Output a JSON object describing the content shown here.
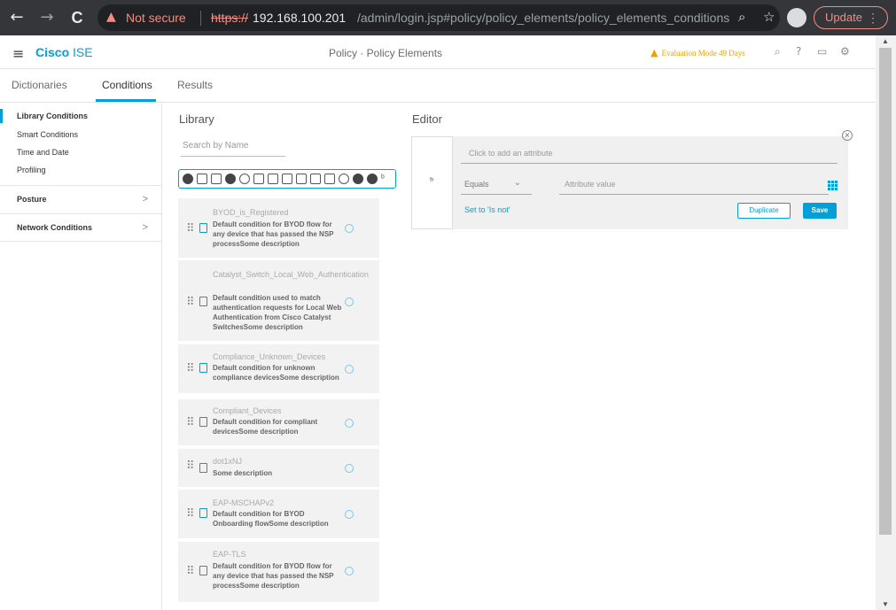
{
  "browser": {
    "not_secure": "Not secure",
    "url_scheme": "https://",
    "url_host": "192.168.100.201",
    "url_path": "/admin/login.jsp#policy/policy_elements/policy_elements_conditions/a...",
    "update_label": "Update",
    "back_glyph": "←",
    "forward_glyph": "→",
    "reload_glyph": "C",
    "zoom_glyph": "⌕",
    "star_glyph": "☆",
    "menu_glyph": "⋮"
  },
  "app": {
    "brand": "Cisco",
    "product": "ISE",
    "page_title": "Policy · Policy Elements",
    "evaluation": "Evaluation Mode 49 Days",
    "accent_color": "#049fd9"
  },
  "tabs": [
    {
      "label": "Dictionaries"
    },
    {
      "label": "Conditions"
    },
    {
      "label": "Results"
    }
  ],
  "sidebar": {
    "items": [
      {
        "label": "Library Conditions"
      },
      {
        "label": "Smart Conditions"
      },
      {
        "label": "Time and Date"
      },
      {
        "label": "Profiling"
      }
    ],
    "groups": [
      {
        "label": "Posture"
      },
      {
        "label": "Network Conditions"
      }
    ]
  },
  "library": {
    "title": "Library",
    "search_placeholder": "Search by Name",
    "cards": [
      {
        "name": "BYOD_is_Registered",
        "desc": "Default condition for BYOD flow for any device that has passed the NSP processSome description"
      },
      {
        "name": "Catalyst_Switch_Local_Web_Authentication",
        "desc": "Default condition used to match authentication requests for Local Web Authentication from Cisco Catalyst SwitchesSome description"
      },
      {
        "name": "Compliance_Unknown_Devices",
        "desc": "Default condition for unknown compliance devicesSome description"
      },
      {
        "name": "Compliant_Devices",
        "desc": "Default condition for compliant devicesSome description"
      },
      {
        "name": "dot1xNJ",
        "desc": "Some description"
      },
      {
        "name": "EAP-MSCHAPv2",
        "desc": "Default condition for BYOD Onboarding flowSome description"
      },
      {
        "name": "EAP-TLS",
        "desc": "Default condition for BYOD flow for any device that has passed the NSP processSome description"
      }
    ]
  },
  "editor": {
    "title": "Editor",
    "attribute_placeholder": "Click to add an attribute",
    "operator": "Equals",
    "value_placeholder": "Attribute value",
    "set_not": "Set to 'Is not'",
    "duplicate_label": "Duplicate",
    "save_label": "Save"
  }
}
